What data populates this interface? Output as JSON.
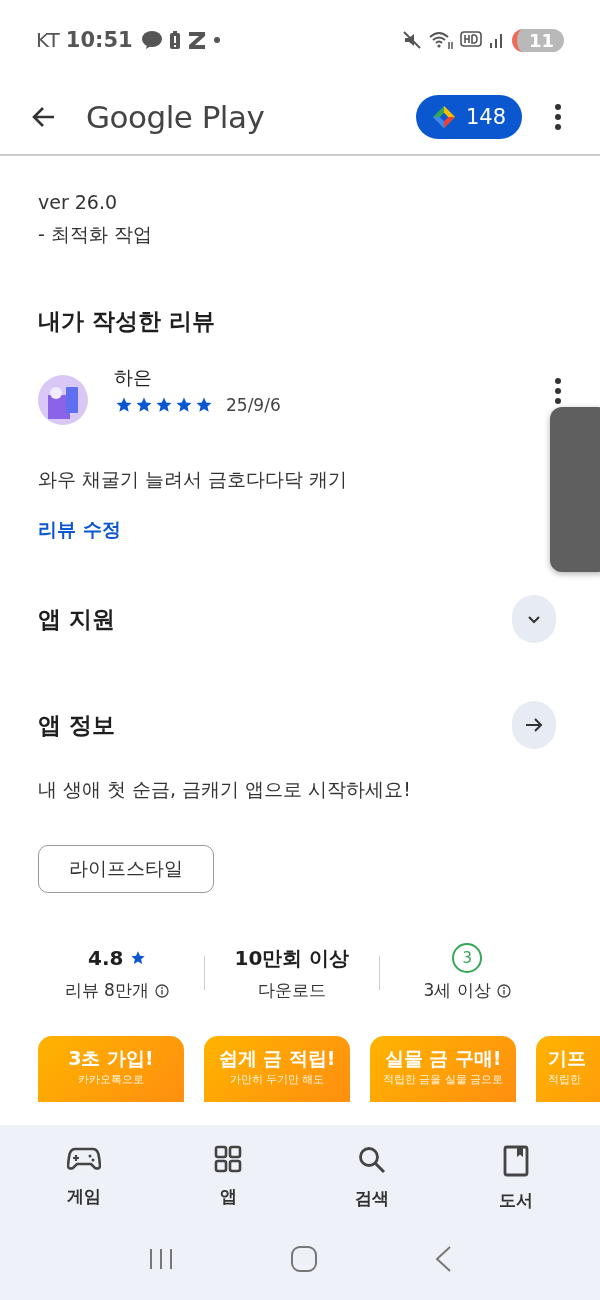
{
  "status_bar": {
    "carrier": "KT",
    "time": "10:51",
    "battery": "11"
  },
  "app_bar": {
    "title": "Google Play",
    "points": "148"
  },
  "whats_new": {
    "version": "ver 26.0",
    "note": "- 최적화 작업"
  },
  "my_review": {
    "heading": "내가 작성한 리뷰",
    "author": "하은",
    "stars": 5,
    "date": "25/9/6",
    "text": "와우 채굴기 늘려서 금호다다닥 캐기",
    "edit_link": "리뷰 수정"
  },
  "sections": [
    {
      "title": "앱 지원",
      "kind": "expand"
    },
    {
      "title": "앱 정보",
      "kind": "arrow"
    }
  ],
  "description": "내 생애 첫 순금, 금캐기 앱으로 시작하세요!",
  "category": "라이프스타일",
  "stats": [
    {
      "kind": "rating",
      "value": "4.8",
      "label": "리뷰 8만개"
    },
    {
      "kind": "plain",
      "value": "10만회 이상",
      "label": "다운로드"
    },
    {
      "kind": "age",
      "value": "3",
      "label": "3세 이상"
    }
  ],
  "screenshots": [
    {
      "title": "3초 가입!",
      "subtitle": "카카오톡으로"
    },
    {
      "title": "쉽게 금 적립!",
      "subtitle": "가만히 두기만 해도"
    },
    {
      "title": "실물 금 구매!",
      "subtitle": "적립한 금을 실물 금으로"
    },
    {
      "title": "기프",
      "subtitle": "적립한"
    }
  ],
  "bottom_nav": [
    {
      "kind": "games",
      "label": "게임",
      "selected": false
    },
    {
      "kind": "apps",
      "label": "앱",
      "selected": false
    },
    {
      "kind": "search",
      "label": "검색",
      "selected": false
    },
    {
      "kind": "books",
      "label": "도서",
      "selected": false
    }
  ]
}
